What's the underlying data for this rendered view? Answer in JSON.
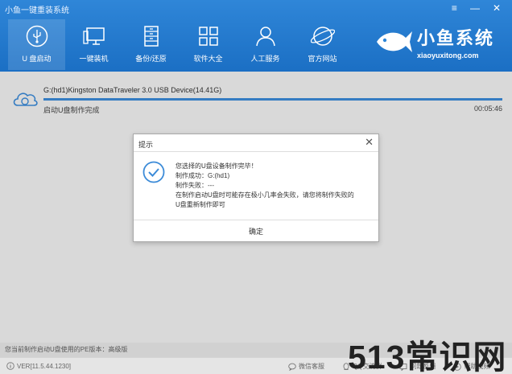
{
  "window": {
    "title": "小鱼一键重装系统",
    "controls": [
      "≡",
      "—",
      "✕"
    ]
  },
  "nav": [
    {
      "label": "U 盘启动",
      "icon": "usb-icon"
    },
    {
      "label": "一键装机",
      "icon": "monitor-icon"
    },
    {
      "label": "备份/还原",
      "icon": "archive-icon"
    },
    {
      "label": "软件大全",
      "icon": "grid-icon"
    },
    {
      "label": "人工服务",
      "icon": "person-icon"
    },
    {
      "label": "官方网站",
      "icon": "globe-icon"
    }
  ],
  "brand": {
    "name": "小鱼系统",
    "domain": "xiaoyuxitong.com"
  },
  "device": {
    "name": "G:(hd1)Kingston DataTraveler 3.0 USB Device(14.41G)",
    "status": "启动U盘制作完成",
    "time": "00:05:46",
    "progress": 1.0
  },
  "dialog": {
    "title": "提示",
    "close": "✕",
    "lines": [
      "您选择的U盘设备制作完毕！",
      "制作成功：G:(hd1)",
      "制作失败：---",
      "在制作启动U盘时可能存在极小几率会失败，请您将制作失败的",
      "U盘重新制作即可"
    ],
    "button": "确定"
  },
  "pe_info": "您当前制作启动U盘使用的PE版本：高级版",
  "footer": {
    "version": "VER[11.5.44.1230]",
    "links": [
      "微信客服",
      "QQ交流群",
      "问题反馈",
      "帮助视频"
    ]
  },
  "watermark": "513常识网",
  "colors": {
    "header": "#2f86d8",
    "accent": "#3c8bd8"
  }
}
